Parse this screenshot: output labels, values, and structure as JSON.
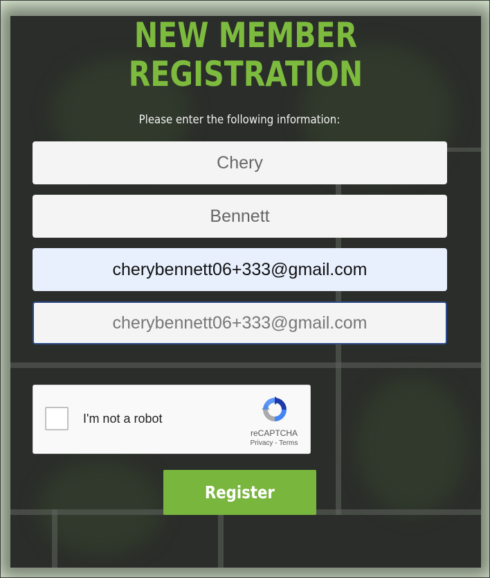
{
  "form": {
    "title_line1": "NEW MEMBER",
    "title_line2": "REGISTRATION",
    "subtitle": "Please enter the following information:",
    "first_name_value": "Chery",
    "last_name_value": "Bennett",
    "email_value": "cherybennett06+333@gmail.com",
    "confirm_email_value": "cherybennett06+333@gmail.com",
    "register_label": "Register"
  },
  "captcha": {
    "label": "I'm not a robot",
    "brand": "reCAPTCHA",
    "privacy_label": "Privacy",
    "separator": " - ",
    "terms_label": "Terms",
    "checked": false
  },
  "colors": {
    "accent_green": "#79b63e",
    "title_green": "#7dbb3e",
    "panel_dark": "#2a2d29",
    "frame_bg": "#dcebd3",
    "focus_border": "#2c4a8c",
    "autofill_bg": "#e8f0fe"
  }
}
